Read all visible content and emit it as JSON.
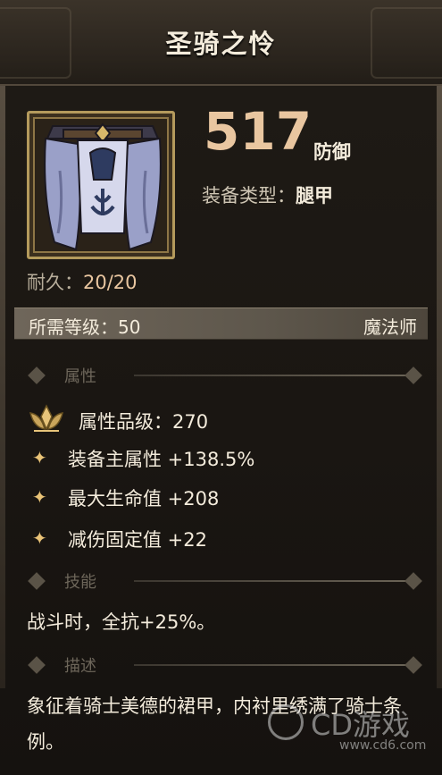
{
  "title": "圣骑之怜",
  "item": {
    "icon": "paladin-leg-armor-icon",
    "defense_value": "517",
    "defense_label": "防御",
    "equip_type_label": "装备类型：",
    "equip_type_value": "腿甲",
    "durability_label": "耐久：",
    "durability_value": "20/20"
  },
  "requirement": {
    "level_text": "所需等级：50",
    "class_text": "魔法师"
  },
  "sections": {
    "attributes": "属性",
    "skills": "技能",
    "description": "描述"
  },
  "attributes": {
    "quality": "属性品级：270",
    "stats": [
      "装备主属性 +138.5%",
      "最大生命值 +208",
      "减伤固定值 +22"
    ]
  },
  "skill_text": "战斗时，全抗+25%。",
  "description_text": "象征着骑士美德的裙甲，内衬里绣满了骑士条例。",
  "watermark": {
    "main": "CD游戏",
    "url": "www.cd6.com"
  },
  "colors": {
    "accent": "#e9c6a0",
    "star": "#e9c377",
    "frame_gold": "#b49a5c"
  }
}
